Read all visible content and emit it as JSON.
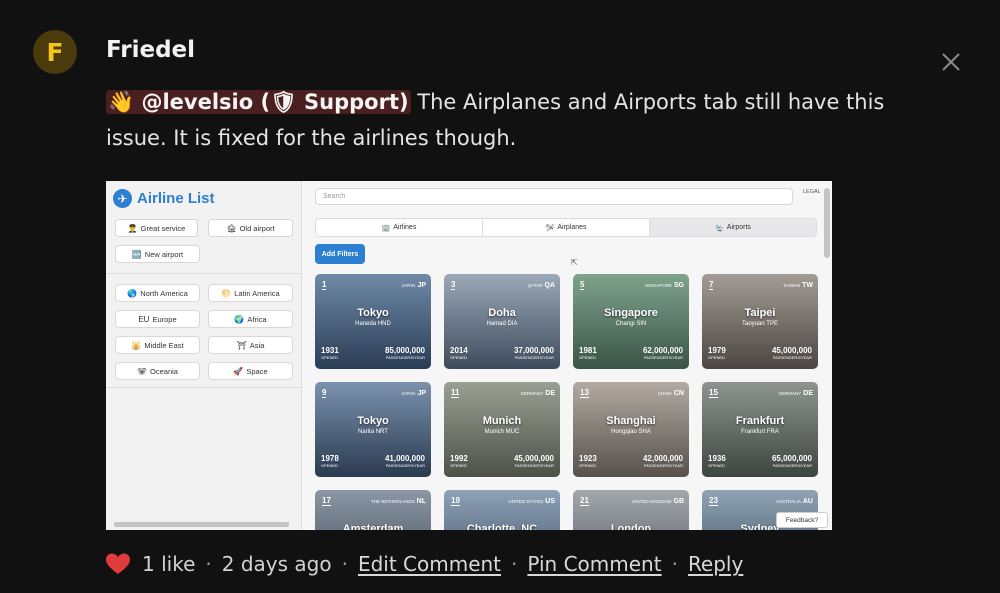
{
  "comment": {
    "avatar_letter": "F",
    "author": "Friedel",
    "mention": "👋 @levelsio (🛡 Support)",
    "text": " The Airplanes and Airports tab still have this issue. It is fixed for the airlines though."
  },
  "screenshot": {
    "logo": "Airline List",
    "filters_top": [
      {
        "icon": "👨‍✈️",
        "label": "Great service"
      },
      {
        "icon": "🏚",
        "label": "Old airport"
      },
      {
        "icon": "🆕",
        "label": "New airport"
      }
    ],
    "regions": [
      {
        "icon": "🌎",
        "label": "North America"
      },
      {
        "icon": "🌕",
        "label": "Latin America"
      },
      {
        "icon": "EU",
        "label": "Europe"
      },
      {
        "icon": "🌍",
        "label": "Africa"
      },
      {
        "icon": "🕌",
        "label": "Middle East"
      },
      {
        "icon": "⛩",
        "label": "Asia"
      },
      {
        "icon": "🐨",
        "label": "Oceania"
      },
      {
        "icon": "🚀",
        "label": "Space"
      }
    ],
    "search_placeholder": "Search",
    "legal": "LEGAL",
    "tabs": [
      {
        "icon": "🏢",
        "label": "Airlines"
      },
      {
        "icon": "🛩",
        "label": "Airplanes"
      },
      {
        "icon": "🛬",
        "label": "Airports"
      }
    ],
    "add_filters": "Add Filters",
    "opened_label": "OPENED",
    "pax_label": "PASSENGERS/YEAR",
    "cards": [
      {
        "num": "1",
        "country": "JAPAN",
        "cc": "JP",
        "city": "Tokyo",
        "code": "Haneda HND",
        "year": "1931",
        "pax": "85,000,000",
        "colors": [
          "#6f8aa8",
          "#2b3c55"
        ]
      },
      {
        "num": "3",
        "country": "QATAR",
        "cc": "QA",
        "city": "Doha",
        "code": "Hamad DIA",
        "year": "2014",
        "pax": "37,000,000",
        "colors": [
          "#9aa8b8",
          "#3e4b5c"
        ]
      },
      {
        "num": "5",
        "country": "SINGAPORE",
        "cc": "SG",
        "city": "Singapore",
        "code": "Changi SIN",
        "year": "1981",
        "pax": "62,000,000",
        "colors": [
          "#7fa38d",
          "#3a5446"
        ]
      },
      {
        "num": "7",
        "country": "TAIWAN",
        "cc": "TW",
        "city": "Taipei",
        "code": "Taoyuan TPE",
        "year": "1979",
        "pax": "45,000,000",
        "colors": [
          "#a39c96",
          "#4b4642"
        ]
      },
      {
        "num": "9",
        "country": "JAPAN",
        "cc": "JP",
        "city": "Tokyo",
        "code": "Narita NRT",
        "year": "1978",
        "pax": "41,000,000",
        "colors": [
          "#7b92ad",
          "#2a3a50"
        ]
      },
      {
        "num": "11",
        "country": "GERMANY",
        "cc": "DE",
        "city": "Munich",
        "code": "Munich MUC",
        "year": "1992",
        "pax": "45,000,000",
        "colors": [
          "#9a9f93",
          "#4d5248"
        ]
      },
      {
        "num": "13",
        "country": "CHINA",
        "cc": "CN",
        "city": "Shanghai",
        "code": "Hongqiao SHA",
        "year": "1923",
        "pax": "42,000,000",
        "colors": [
          "#b2aaa2",
          "#56514b"
        ]
      },
      {
        "num": "15",
        "country": "GERMANY",
        "cc": "DE",
        "city": "Frankfurt",
        "code": "Frankfurt FRA",
        "year": "1936",
        "pax": "65,000,000",
        "colors": [
          "#8d9590",
          "#3e4541"
        ]
      },
      {
        "num": "17",
        "country": "THE NETHERLANDS",
        "cc": "NL",
        "city": "Amsterdam",
        "code": "",
        "year": "",
        "pax": "",
        "colors": [
          "#8c97a5",
          "#3f4956"
        ]
      },
      {
        "num": "19",
        "country": "UNITED STATES",
        "cc": "US",
        "city": "Charlotte, NC",
        "code": "",
        "year": "",
        "pax": "",
        "colors": [
          "#8ea2b8",
          "#3c4c5f"
        ]
      },
      {
        "num": "21",
        "country": "UNITED KINGDOM",
        "cc": "GB",
        "city": "London",
        "code": "",
        "year": "",
        "pax": "",
        "colors": [
          "#a3a8ad",
          "#50555b"
        ]
      },
      {
        "num": "23",
        "country": "AUSTRALIA",
        "cc": "AU",
        "city": "Sydney",
        "code": "",
        "year": "",
        "pax": "",
        "colors": [
          "#8fa3b4",
          "#3d4e5e"
        ]
      }
    ],
    "feedback": "Feedback?"
  },
  "footer": {
    "likes": "1 like",
    "time": "2 days ago",
    "edit": "Edit Comment",
    "pin": "Pin Comment",
    "reply": "Reply"
  },
  "colors": {
    "heart": "#e23b3b",
    "accent": "#2c7fd1",
    "mention_bg": "#4a1f1f"
  }
}
